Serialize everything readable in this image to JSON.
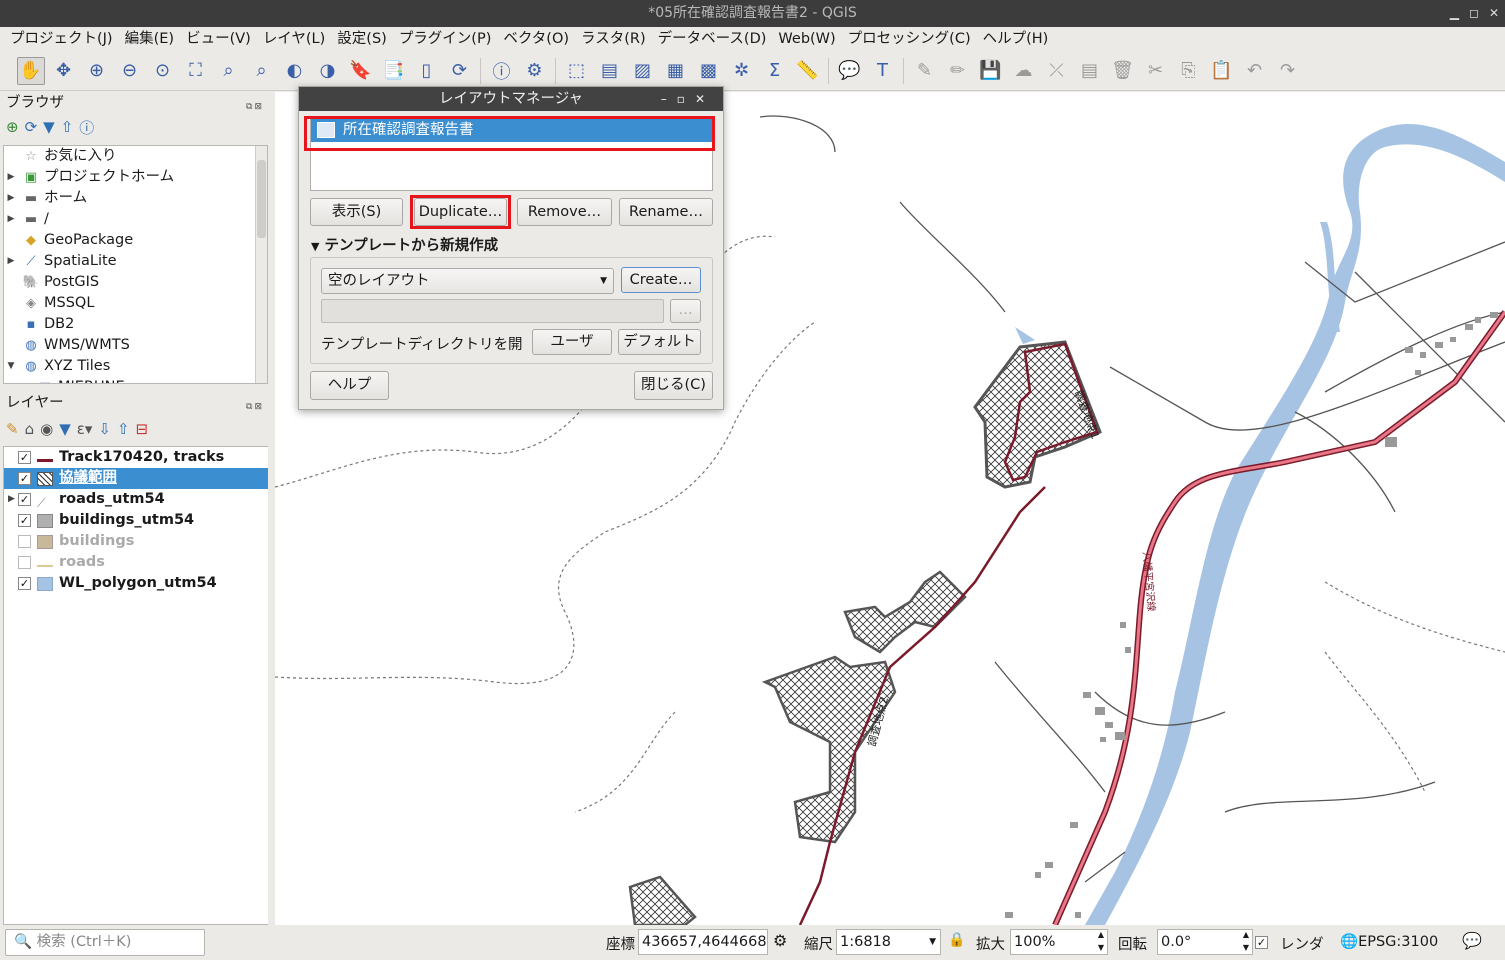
{
  "window": {
    "title": "*05所在確認調査報告書2 - QGIS"
  },
  "menu": [
    "プロジェクト(J)",
    "編集(E)",
    "ビュー(V)",
    "レイヤ(L)",
    "設定(S)",
    "プラグイン(P)",
    "ベクタ(O)",
    "ラスタ(R)",
    "データベース(D)",
    "Web(W)",
    "プロセッシング(C)",
    "ヘルプ(H)"
  ],
  "toolbar_icons": [
    "pan-icon",
    "pan-to-selection-icon",
    "zoom-in-icon",
    "zoom-out-icon",
    "zoom-native-icon",
    "zoom-full-icon",
    "zoom-to-selection-icon",
    "zoom-to-layer-icon",
    "zoom-last-icon",
    "zoom-next-icon",
    "new-bookmark-icon",
    "show-bookmarks-icon",
    "new-map-view-icon",
    "refresh-icon",
    "identify-icon",
    "measure-icon",
    "select-icon",
    "select-by-value-icon",
    "deselect-icon",
    "attribute-table-icon",
    "field-calculator-icon",
    "statistics-icon",
    "sum-icon",
    "measure-line-icon",
    "map-tips-icon",
    "text-annotation-icon",
    "digitize-icon",
    "edit-pencil-icon",
    "save-edits-icon",
    "add-feature-icon",
    "node-tool-icon",
    "modify-attributes-icon",
    "delete-icon",
    "cut-icon",
    "copy-icon",
    "paste-icon",
    "undo-icon",
    "redo-icon"
  ],
  "browser": {
    "title": "ブラウザ",
    "items": [
      {
        "label": "お気に入り",
        "icon": "star-icon",
        "expandable": false
      },
      {
        "label": "プロジェクトホーム",
        "icon": "project-home-icon",
        "expandable": true
      },
      {
        "label": "ホーム",
        "icon": "folder-icon",
        "expandable": true
      },
      {
        "label": "/",
        "icon": "folder-icon",
        "expandable": true
      },
      {
        "label": "GeoPackage",
        "icon": "geopackage-icon",
        "expandable": false
      },
      {
        "label": "SpatiaLite",
        "icon": "spatialite-icon",
        "expandable": true
      },
      {
        "label": "PostGIS",
        "icon": "postgis-icon",
        "expandable": false
      },
      {
        "label": "MSSQL",
        "icon": "mssql-icon",
        "expandable": false
      },
      {
        "label": "DB2",
        "icon": "db2-icon",
        "expandable": false
      },
      {
        "label": "WMS/WMTS",
        "icon": "wms-icon",
        "expandable": false
      },
      {
        "label": "XYZ Tiles",
        "icon": "xyz-icon",
        "expandable": true
      },
      {
        "label": "MIERUNE",
        "icon": "xyz-item-icon",
        "expandable": false
      }
    ]
  },
  "layers": {
    "title": "レイヤー",
    "items": [
      {
        "label": "Track170420, tracks",
        "checked": true,
        "selected": false,
        "symbol": "line-red",
        "enabled": true
      },
      {
        "label": "協議範囲",
        "checked": true,
        "selected": true,
        "symbol": "hatch",
        "enabled": true
      },
      {
        "label": "roads_utm54",
        "checked": true,
        "selected": false,
        "symbol": "categorized",
        "enabled": true,
        "expandable": true
      },
      {
        "label": "buildings_utm54",
        "checked": true,
        "selected": false,
        "symbol": "fill-gray",
        "enabled": true
      },
      {
        "label": "buildings",
        "checked": false,
        "selected": false,
        "symbol": "fill-tan",
        "enabled": false
      },
      {
        "label": "roads",
        "checked": false,
        "selected": false,
        "symbol": "line-tan",
        "enabled": false
      },
      {
        "label": "WL_polygon_utm54",
        "checked": true,
        "selected": false,
        "symbol": "fill-blue",
        "enabled": true
      }
    ]
  },
  "layout_manager": {
    "title": "レイアウトマネージャ",
    "layouts": [
      "所在確認調査報告書"
    ],
    "buttons": {
      "show": "表示(S)",
      "duplicate": "Duplicate…",
      "remove": "Remove…",
      "rename": "Rename…"
    },
    "template_section": "テンプレートから新規作成",
    "template_select": "空のレイアウト",
    "create": "Create…",
    "browse": "…",
    "template_dir_label": "テンプレートディレクトリを開",
    "user": "ユーザ",
    "default": "デフォルト",
    "help": "ヘルプ",
    "close": "閉じる(C)"
  },
  "map_labels": {
    "site1": "調査地点1",
    "site2": "調査地点2",
    "road": "八幡平宮沢線"
  },
  "status": {
    "search_placeholder": "検索 (Ctrl＋K)",
    "coord_label": "座標",
    "coord_value": "436657,4644668",
    "scale_label": "縮尺",
    "scale_value": "1:6818",
    "magnifier_label": "拡大",
    "magnifier_value": "100%",
    "rotation_label": "回転",
    "rotation_value": "0.0°",
    "render_label": "レンダ",
    "crs": "EPSG:3100"
  },
  "colors": {
    "selection": "#3b8ed0",
    "highlight": "#e8141c",
    "river": "#a7c3e3",
    "road": "#d93a4a",
    "site": "#7a1a2a"
  }
}
